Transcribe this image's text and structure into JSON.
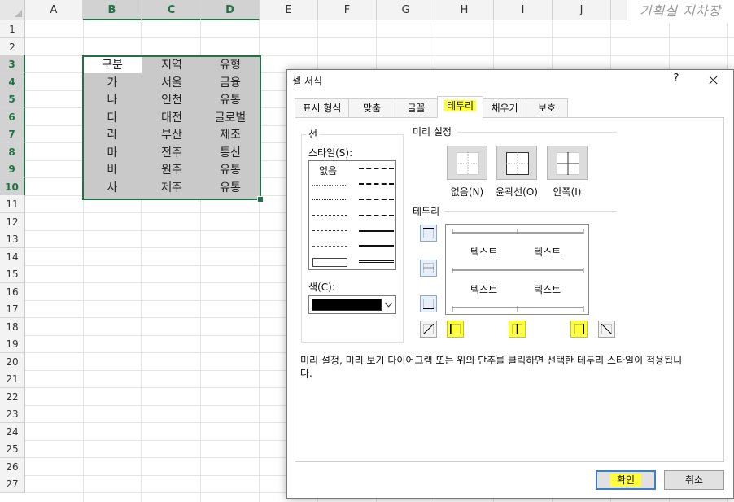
{
  "sheet": {
    "columns": [
      "A",
      "B",
      "C",
      "D",
      "E",
      "F",
      "G",
      "H",
      "I",
      "J"
    ],
    "rows": [
      "1",
      "2",
      "3",
      "4",
      "5",
      "6",
      "7",
      "8",
      "9",
      "10",
      "11",
      "12",
      "13",
      "14",
      "15",
      "16",
      "17",
      "18",
      "19",
      "20",
      "21",
      "22",
      "23",
      "24",
      "25",
      "26",
      "27"
    ],
    "table": [
      [
        "구분",
        "지역",
        "유형"
      ],
      [
        "가",
        "서울",
        "금융"
      ],
      [
        "나",
        "인천",
        "유통"
      ],
      [
        "다",
        "대전",
        "글로벌"
      ],
      [
        "라",
        "부산",
        "제조"
      ],
      [
        "마",
        "전주",
        "통신"
      ],
      [
        "바",
        "원주",
        "유통"
      ],
      [
        "사",
        "제주",
        "유통"
      ]
    ]
  },
  "watermark": "기획실 지차장",
  "dialog": {
    "title": "셀 서식",
    "help": "?",
    "tabs": [
      "표시 형식",
      "맞춤",
      "글꼴",
      "테두리",
      "채우기",
      "보호"
    ],
    "active_tab": "테두리",
    "line_group": "선",
    "style_label": "스타일(S):",
    "style_none": "없음",
    "color_label": "색(C):",
    "color_value": "#000000",
    "presets_group": "미리 설정",
    "presets": [
      "없음(N)",
      "윤곽선(O)",
      "안쪽(I)"
    ],
    "border_group": "테두리",
    "preview_text": [
      "텍스트",
      "텍스트",
      "텍스트",
      "텍스트"
    ],
    "description": "미리 설정, 미리 보기 다이어그램 또는 위의 단추를 클릭하면 선택한 테두리 스타일이 적용됩니다.",
    "ok": "확인",
    "cancel": "취소"
  },
  "colors": {
    "excel_green": "#217346",
    "highlight": "#ffff3a",
    "selection_fill": "#c9c9c9"
  }
}
